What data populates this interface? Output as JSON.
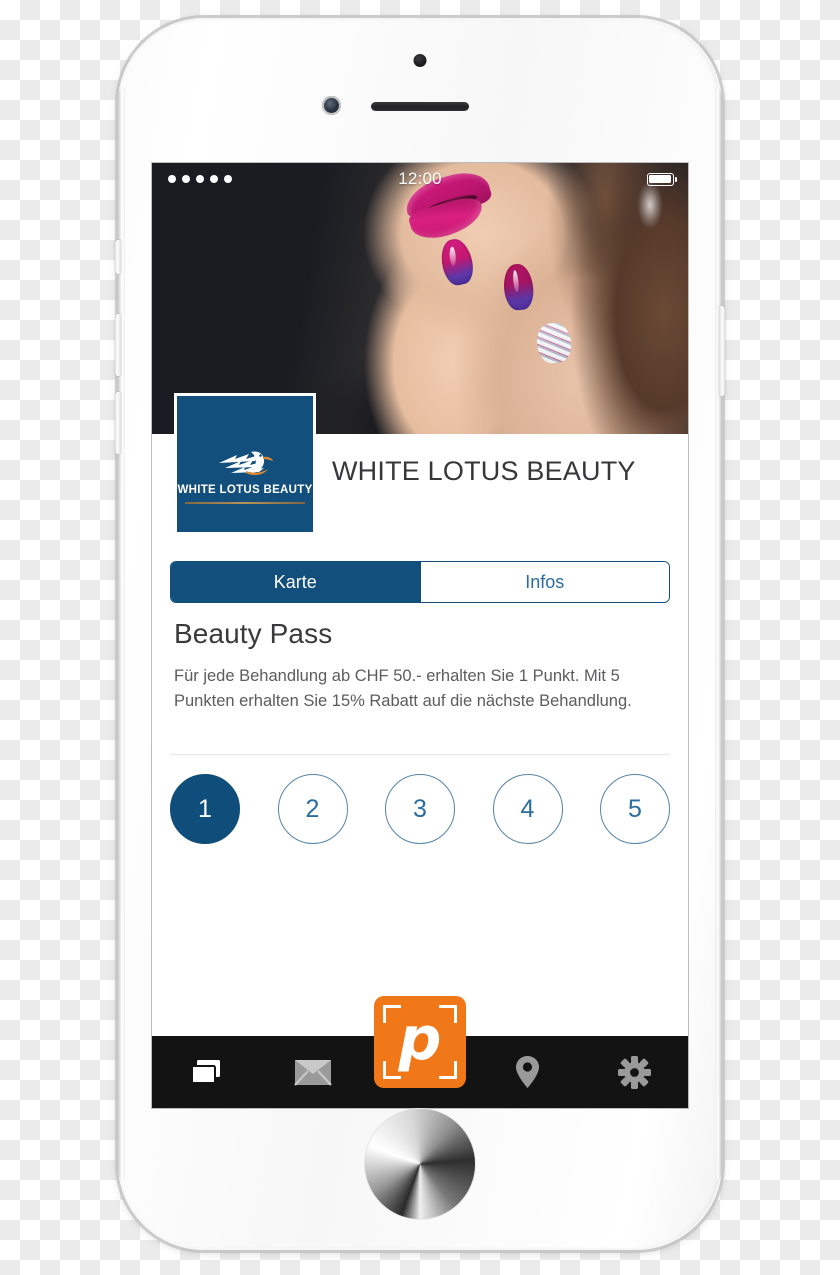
{
  "device": {
    "name": "iphone-6-silver",
    "hardware": {
      "earpiece": "earpiece-speaker",
      "front_camera": "front-camera",
      "sensor": "proximity-sensor",
      "home_button": "home-button",
      "power_button": "power-button",
      "volume_up": "volume-up-button",
      "volume_down": "volume-down-button",
      "silent_switch": "silent-switch"
    }
  },
  "status_bar": {
    "signal_dots": 5,
    "time": "12:00",
    "battery_level_pct": 86
  },
  "hero": {
    "alt": "close-up of woman with magenta lips and painted fingernails"
  },
  "business": {
    "title": "WHITE LOTUS BEAUTY",
    "logo_name": "WHITE LOTUS BEAUTY",
    "logo_bg_color": "#124f7c",
    "logo_mark": "swan-lotus-icon"
  },
  "tabs": [
    {
      "label": "Karte",
      "active": true
    },
    {
      "label": "Infos",
      "active": false
    }
  ],
  "pass": {
    "title": "Beauty Pass",
    "description": "Für jede Behandlung ab CHF 50.- erhalten Sie 1 Punkt. Mit 5 Punkten erhalten Sie 15% Rabatt auf die nächste Behandlung.",
    "points": [
      {
        "label": "1",
        "filled": true
      },
      {
        "label": "2",
        "filled": false
      },
      {
        "label": "3",
        "filled": false
      },
      {
        "label": "4",
        "filled": false
      },
      {
        "label": "5",
        "filled": false
      }
    ]
  },
  "bottom_nav": {
    "items": [
      {
        "icon": "cards-icon",
        "active": true
      },
      {
        "icon": "envelope-icon",
        "active": false
      },
      {
        "icon": "location-pin-icon",
        "active": false
      },
      {
        "icon": "gear-icon",
        "active": false
      }
    ],
    "scan_button": {
      "letter": "p",
      "icon": "scan-frame-icon",
      "color": "#f07818"
    }
  },
  "colors": {
    "brand_blue": "#124f7c",
    "brand_blue_fill": "#0f4d7a",
    "tab_text_blue": "#2b6d9e",
    "accent_orange": "#f07818",
    "nav_bar_black": "#131313"
  }
}
